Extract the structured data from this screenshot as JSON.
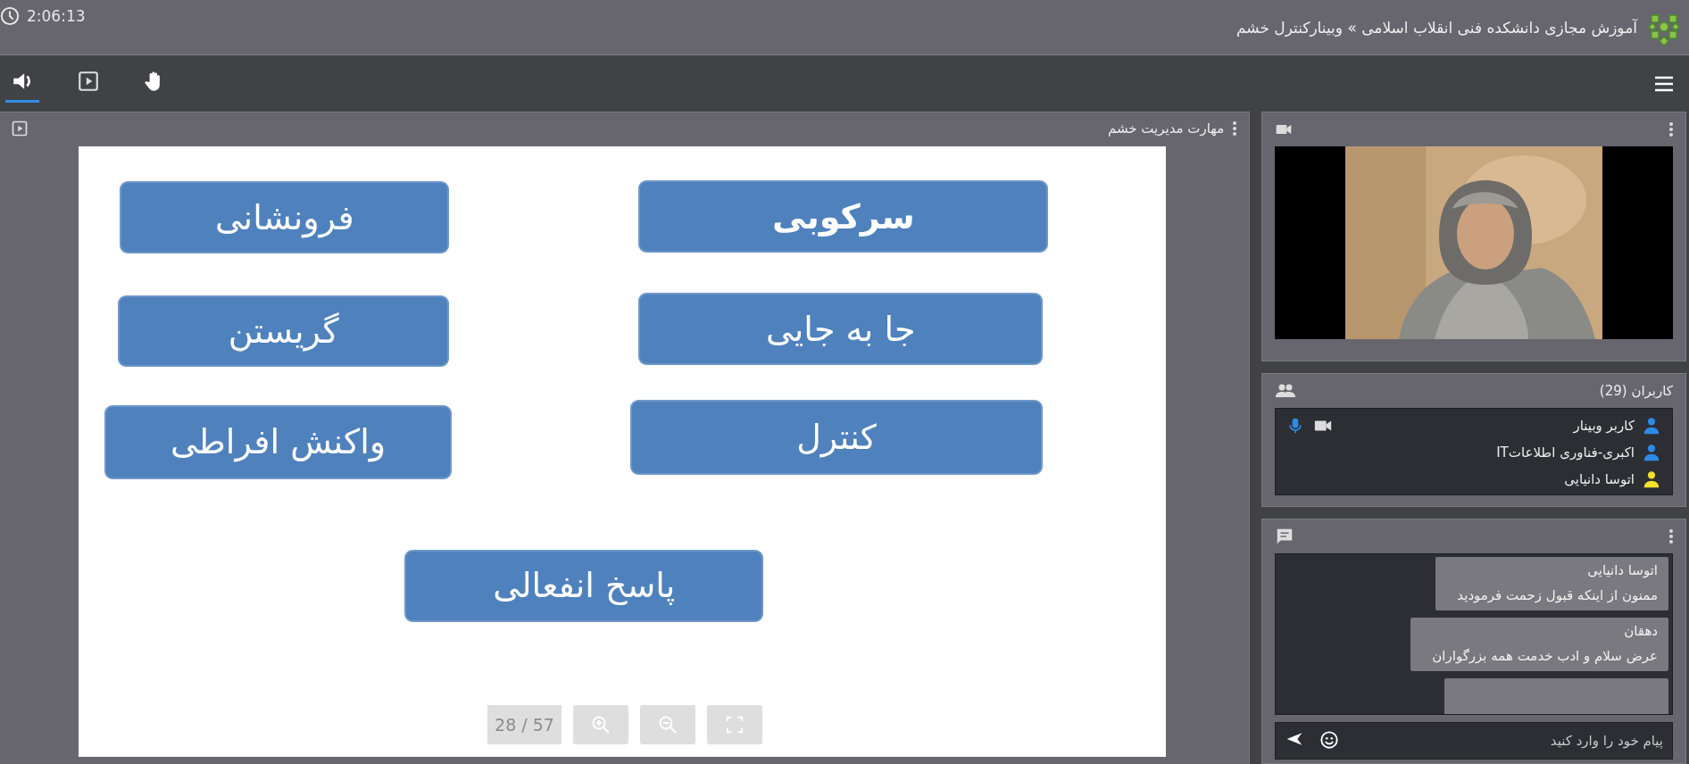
{
  "header": {
    "clock": "2:06:13",
    "title": "آموزش مجازی دانشکده فنی انقلاب اسلامی » وبینارکنترل خشم"
  },
  "toolbar": {
    "tools": [
      {
        "kind": "audio",
        "selected": true
      },
      {
        "kind": "presentation",
        "selected": false
      },
      {
        "kind": "hand",
        "selected": false
      }
    ]
  },
  "presentation": {
    "title": "مهارت مدیریت خشم",
    "page": "28 / 57",
    "shapes": [
      {
        "text": "سرکوبی",
        "bold": true
      },
      {
        "text": "فرونشانی",
        "bold": false
      },
      {
        "text": "جا به جایی",
        "bold": false
      },
      {
        "text": "گریستن",
        "bold": false
      },
      {
        "text": "کنترل",
        "bold": false
      },
      {
        "text": "واکنش افراطی",
        "bold": false
      },
      {
        "text": "پاسخ انفعالی",
        "bold": false
      }
    ]
  },
  "users": {
    "title": "کاربران (29)",
    "list": [
      {
        "name": "کاربر وبینار",
        "color": "#2e8ae6",
        "mic": true,
        "camera": true
      },
      {
        "name": "اکبری-فناوری اطلاعاتIT",
        "color": "#2e8ae6",
        "mic": false,
        "camera": false
      },
      {
        "name": "اتوسا دانیایی",
        "color": "#f2e02c",
        "mic": false,
        "camera": false
      }
    ]
  },
  "chat": {
    "messages": [
      {
        "sender": "اتوسا دانیایی",
        "text": "ممنون از اینکه قبول زحمت فرمودید"
      },
      {
        "sender": "دهقان",
        "text": "عرض سلام و ادب خدمت همه بزرگواران"
      }
    ],
    "input": {
      "placeholder": "پیام خود را وارد کنید"
    }
  }
}
